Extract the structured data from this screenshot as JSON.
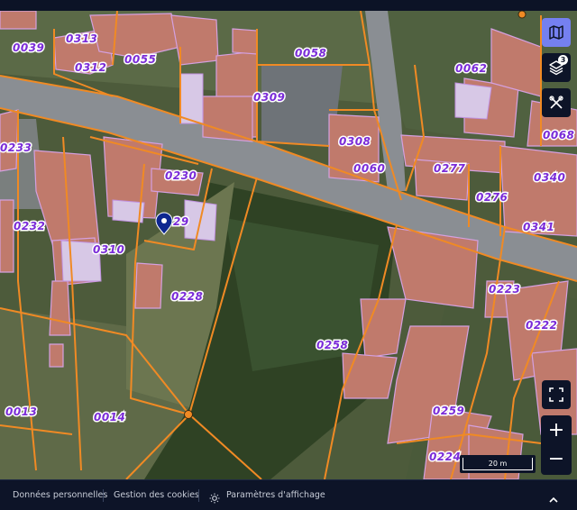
{
  "map": {
    "parcels": [
      {
        "id": "0039",
        "label": "0039"
      },
      {
        "id": "0313",
        "label": "0313"
      },
      {
        "id": "0312",
        "label": "0312"
      },
      {
        "id": "0055",
        "label": "0055"
      },
      {
        "id": "0058",
        "label": "0058"
      },
      {
        "id": "0062",
        "label": "0062"
      },
      {
        "id": "0309",
        "label": "0309"
      },
      {
        "id": "0308",
        "label": "0308"
      },
      {
        "id": "0060",
        "label": "0060"
      },
      {
        "id": "0068",
        "label": "0068"
      },
      {
        "id": "0233",
        "label": "0233"
      },
      {
        "id": "0230",
        "label": "0230"
      },
      {
        "id": "0277",
        "label": "0277"
      },
      {
        "id": "0340",
        "label": "0340"
      },
      {
        "id": "0276",
        "label": "0276"
      },
      {
        "id": "0232",
        "label": "0232"
      },
      {
        "id": "0229",
        "label": "29"
      },
      {
        "id": "0341",
        "label": "0341"
      },
      {
        "id": "0310",
        "label": "0310"
      },
      {
        "id": "0228",
        "label": "0228"
      },
      {
        "id": "0223",
        "label": "0223"
      },
      {
        "id": "0222",
        "label": "0222"
      },
      {
        "id": "0258",
        "label": "0258"
      },
      {
        "id": "0013",
        "label": "0013"
      },
      {
        "id": "0014",
        "label": "0014"
      },
      {
        "id": "0259",
        "label": "0259"
      },
      {
        "id": "0224",
        "label": "0224"
      }
    ],
    "layers_count": "3",
    "scale_label": "20 m",
    "zoom_in_label": "+",
    "zoom_out_label": "−",
    "colors": {
      "parcel_border": "#f08a24",
      "building": "#c07a6c",
      "parcel_label": "#7a2bd8",
      "accent": "#7580f0",
      "marker": "#0e2790",
      "panel": "#0d1428"
    },
    "icons": {
      "map_view": "map-icon",
      "layers": "layers-icon",
      "tools": "tools-icon",
      "fullscreen": "fullscreen-icon",
      "marker": "location-marker-icon"
    }
  },
  "footer": {
    "personal_data": "Données personnelles",
    "cookies": "Gestion des cookies",
    "display_settings": "Paramètres d'affichage"
  }
}
